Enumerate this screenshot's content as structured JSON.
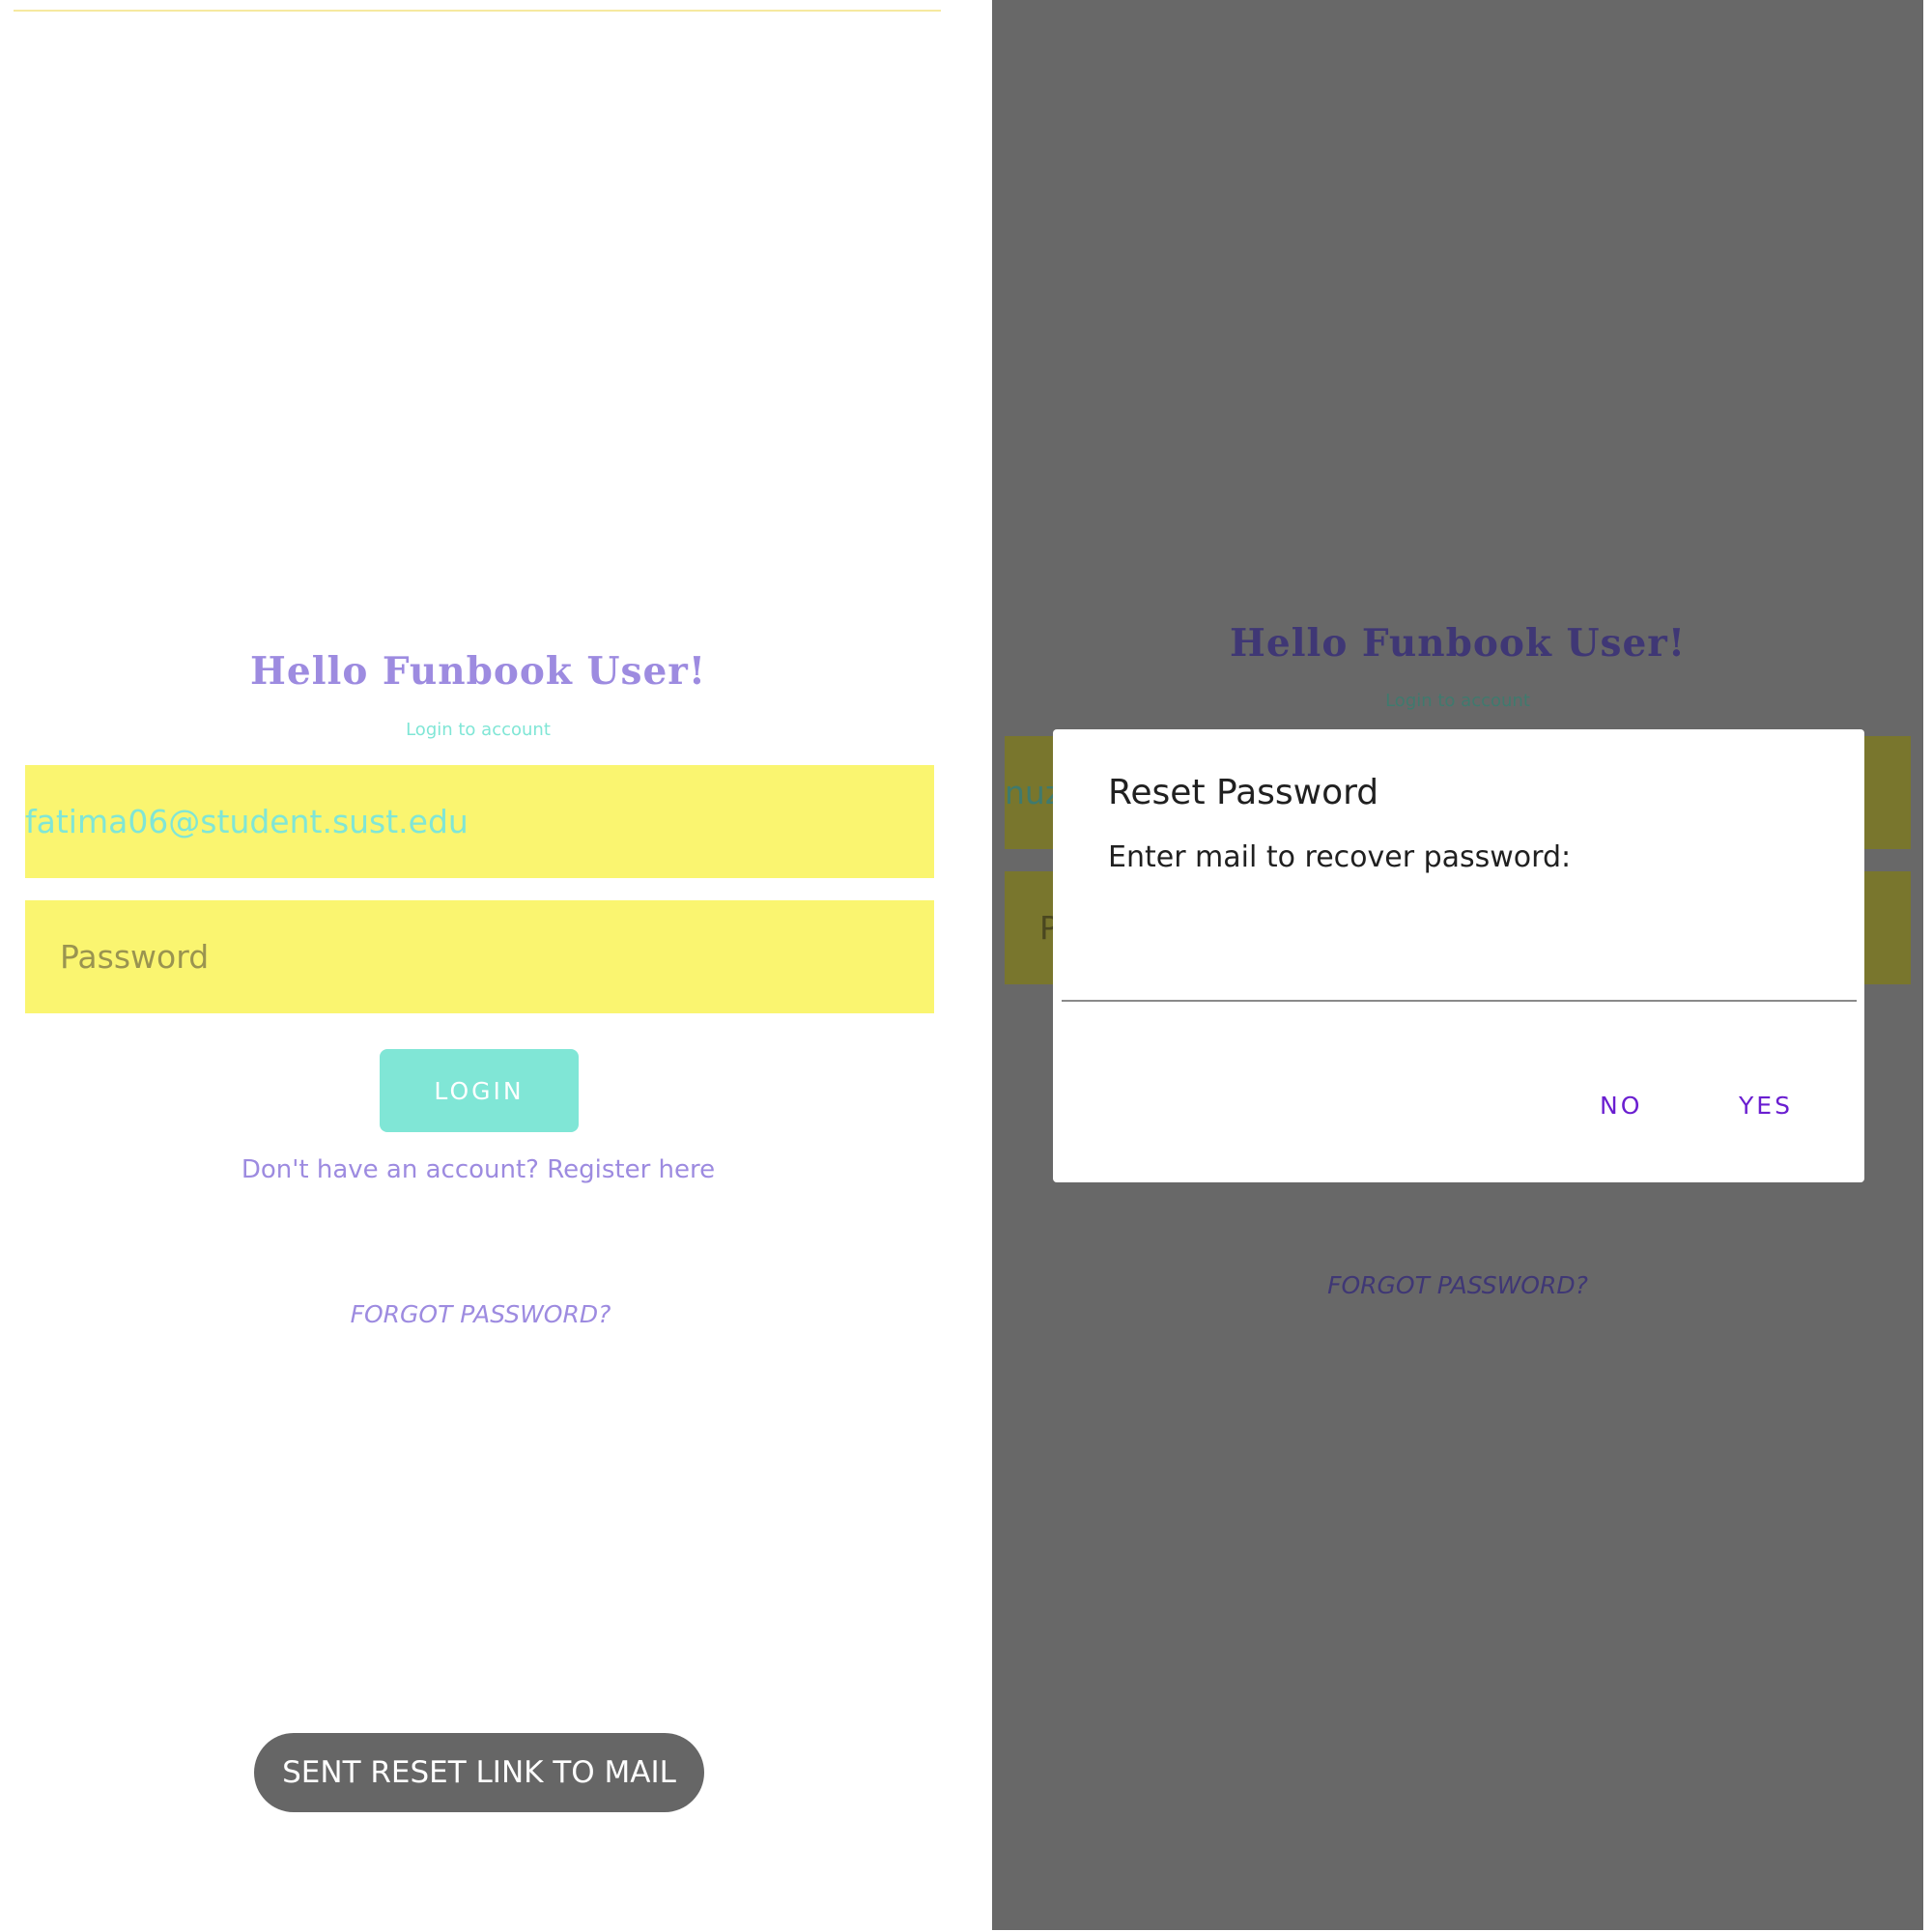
{
  "colors": {
    "title_purple": "#9d8be0",
    "teal": "#80e6d6",
    "input_yellow": "#faf570",
    "email_text": "#80e6d6",
    "placeholder": "#9a9450",
    "toast_bg": "#666666",
    "scrim": "#686868",
    "dim_title": "#3f3775",
    "dim_subtitle": "#3f7a6e",
    "dialog_button": "#6a1ed0"
  },
  "login_screen": {
    "title": "Hello Funbook User!",
    "subtitle": "Login to account",
    "email_value": "fatima06@student.sust.edu",
    "password_placeholder": "Password",
    "login_button": "LOGIN",
    "register_link": "Don't have an account? Register here",
    "forgot_password": "FORGOT PASSWORD?",
    "toast": "SENT RESET LINK TO MAIL"
  },
  "dialog_screen": {
    "title": "Hello Funbook User!",
    "subtitle": "Login to account",
    "email_partial": "nuz",
    "password_partial": "P",
    "forgot_password": "FORGOT PASSWORD?",
    "dialog": {
      "title": "Reset Password",
      "message": "Enter mail to recover password:",
      "input_value": "",
      "no_button": "NO",
      "yes_button": "YES"
    }
  }
}
